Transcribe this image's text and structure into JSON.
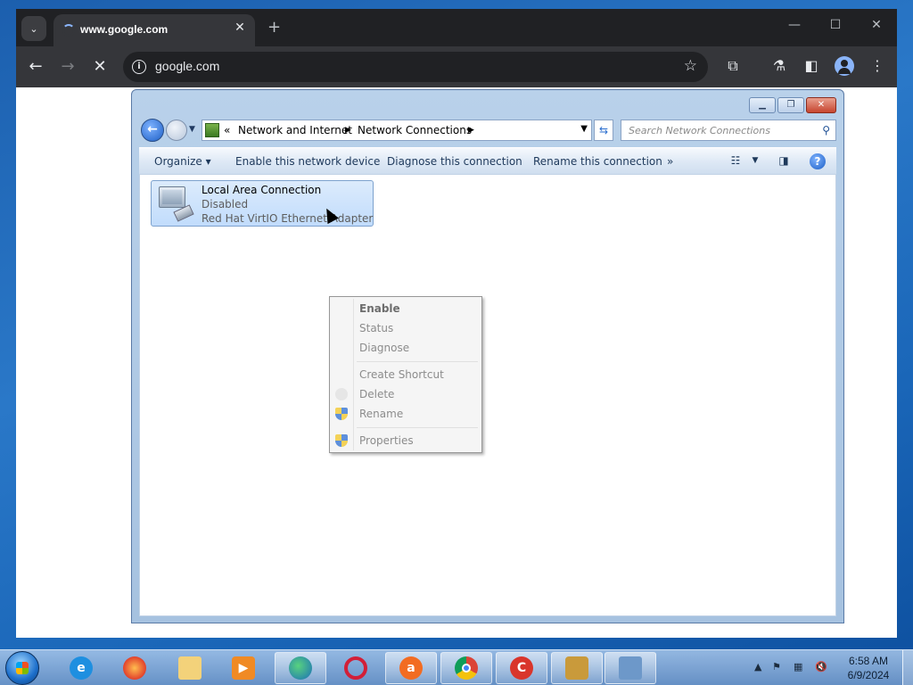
{
  "browser": {
    "tab_title": "www.google.com",
    "url": "google.com"
  },
  "explorer": {
    "breadcrumb": [
      "«",
      "Network and Internet",
      "Network Connections"
    ],
    "search_placeholder": "Search Network Connections",
    "commands": {
      "organize": "Organize",
      "enable": "Enable this network device",
      "diagnose": "Diagnose this connection",
      "rename": "Rename this connection",
      "more": "»"
    },
    "connection": {
      "name": "Local Area Connection",
      "status": "Disabled",
      "adapter": "Red Hat VirtIO Ethernet Adapter"
    },
    "context_menu": {
      "enable": "Enable",
      "status": "Status",
      "diagnose": "Diagnose",
      "create_shortcut": "Create Shortcut",
      "delete": "Delete",
      "rename": "Rename",
      "properties": "Properties"
    }
  },
  "taskbar": {
    "apps": [
      "start",
      "internet-explorer",
      "firefox",
      "file-explorer",
      "media-player",
      "edge",
      "opera",
      "avast",
      "chrome",
      "ccleaner",
      "cleanup",
      "network"
    ],
    "time": "6:58 AM",
    "date": "6/9/2024"
  },
  "colors": {
    "chrome_dark": "#202124",
    "chrome_tab": "#35363a",
    "explorer_frame": "#b9d1ea",
    "selection": "#c1dcfc"
  }
}
